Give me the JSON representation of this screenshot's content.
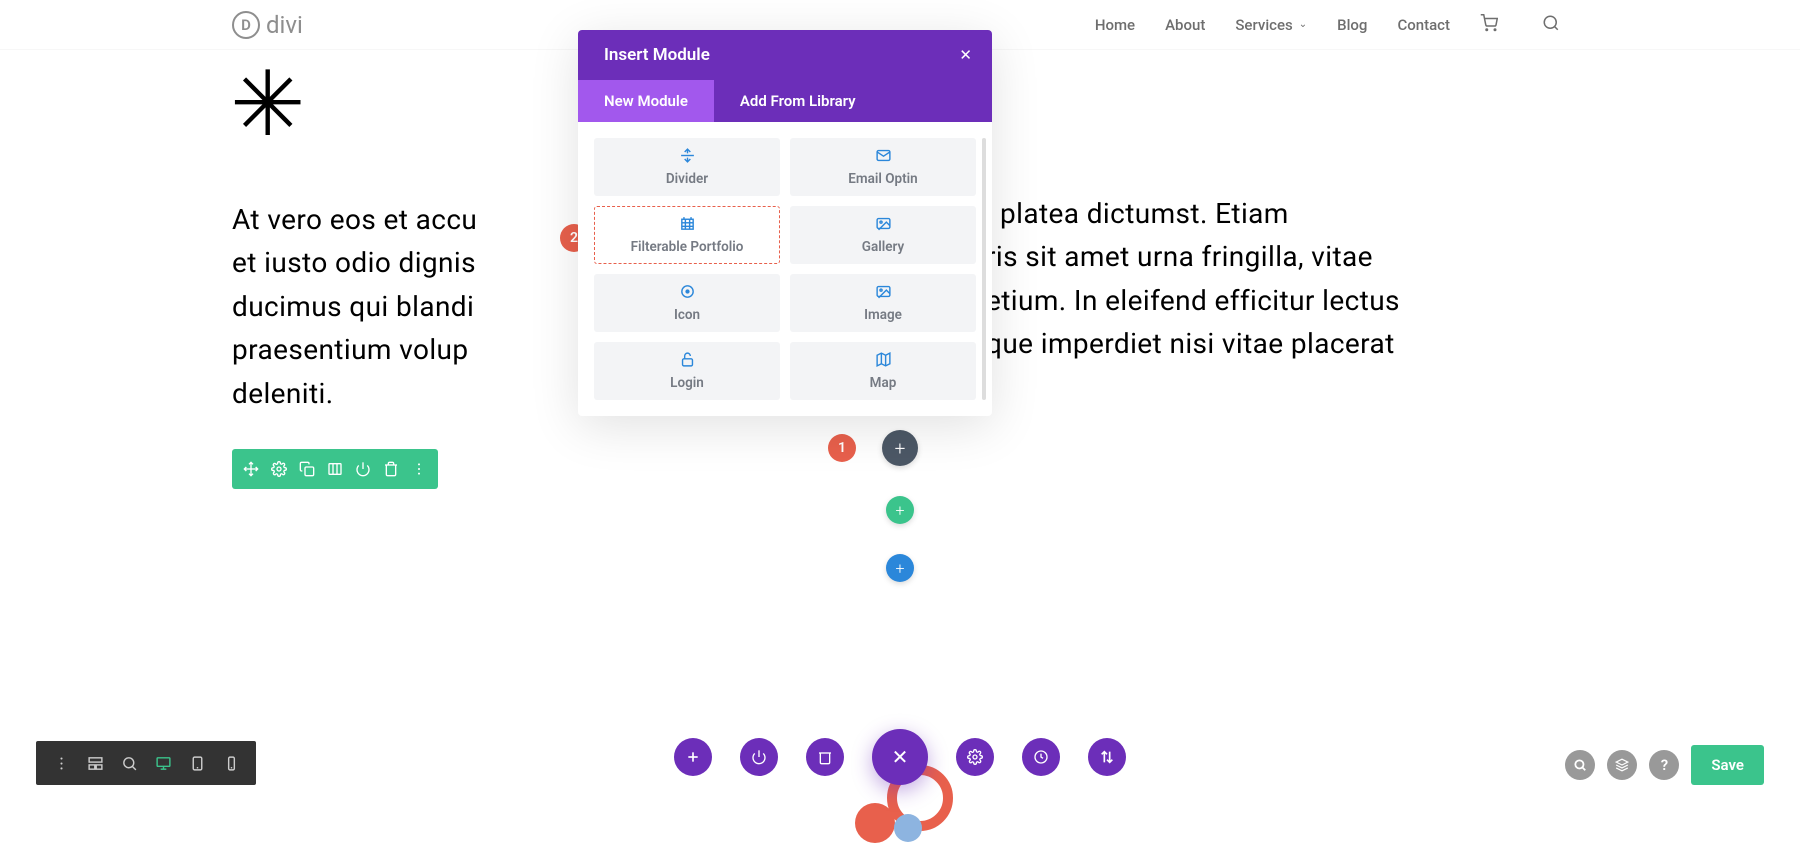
{
  "brand": "divi",
  "nav": {
    "items": [
      "Home",
      "About",
      "Services",
      "Blog",
      "Contact"
    ]
  },
  "page": {
    "heading_line1": "At vero eos et accu",
    "heading_line2": "et iusto odio dignis",
    "heading_line3": "ducimus qui blandi",
    "heading_line4": "praesentium volup",
    "heading_line5": "deleniti.",
    "col2_line1": "platea dictumst. Etiam",
    "col2_line2": "ris sit amet urna fringilla, vitae",
    "col2_line3": "etium. In eleifend efficitur lectus",
    "col2_line4": "que imperdiet nisi vitae placerat"
  },
  "modal": {
    "title": "Insert Module",
    "tabs": {
      "new": "New Module",
      "library": "Add From Library"
    },
    "items": [
      {
        "name": "divider",
        "label": "Divider"
      },
      {
        "name": "email-optin",
        "label": "Email Optin"
      },
      {
        "name": "filterable-portfolio",
        "label": "Filterable Portfolio"
      },
      {
        "name": "gallery",
        "label": "Gallery"
      },
      {
        "name": "icon",
        "label": "Icon"
      },
      {
        "name": "image",
        "label": "Image"
      },
      {
        "name": "login",
        "label": "Login"
      },
      {
        "name": "map",
        "label": "Map"
      }
    ]
  },
  "callouts": {
    "one": "1",
    "two": "2"
  },
  "save_label": "Save"
}
